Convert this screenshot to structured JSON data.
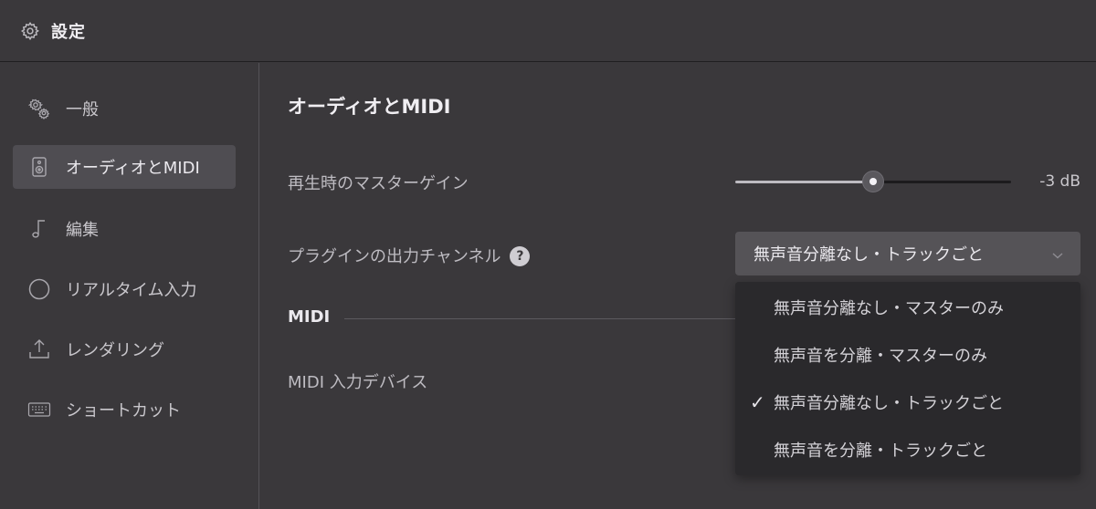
{
  "window": {
    "title": "設定"
  },
  "sidebar": {
    "items": [
      {
        "label": "一般",
        "icon": "gears-icon",
        "active": false
      },
      {
        "label": "オーディオとMIDI",
        "icon": "speaker-icon",
        "active": true
      },
      {
        "label": "編集",
        "icon": "music-note-icon",
        "active": false
      },
      {
        "label": "リアルタイム入力",
        "icon": "circle-icon",
        "active": false
      },
      {
        "label": "レンダリング",
        "icon": "upload-icon",
        "active": false
      },
      {
        "label": "ショートカット",
        "icon": "keyboard-icon",
        "active": false
      }
    ]
  },
  "main": {
    "section_title": "オーディオとMIDI",
    "master_gain": {
      "label": "再生時のマスターゲイン",
      "value": "-3 dB",
      "level": 0.5
    },
    "plugin_output": {
      "label": "プラグインの出力チャンネル",
      "help": "?",
      "selected": "無声音分離なし・トラックごと",
      "options": [
        "無声音分離なし・マスターのみ",
        "無声音を分離・マスターのみ",
        "無声音分離なし・トラックごと",
        "無声音を分離・トラックごと"
      ],
      "check": "✓"
    },
    "midi_section": "MIDI",
    "midi_input": {
      "label": "MIDI 入力デバイス"
    }
  },
  "colors": {
    "background": "#3a383b",
    "active_item": "#4f4d52",
    "dropdown": "#2a292c"
  }
}
